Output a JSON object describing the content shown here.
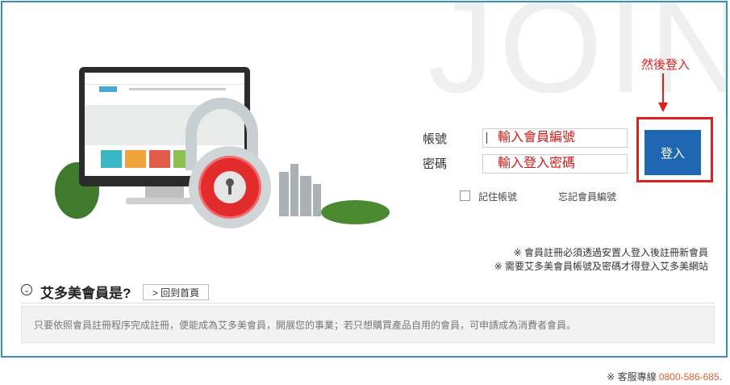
{
  "background_text": "JOIN",
  "annotation": {
    "text": "然後登入",
    "color": "#e0201f"
  },
  "form": {
    "account_label": "帳號",
    "account_placeholder": "輸入會員編號",
    "password_label": "密碼",
    "password_placeholder": "輸入登入密碼",
    "login_button": "登入",
    "remember_label": "記住帳號",
    "forgot_link": "忘記會員編號"
  },
  "notes": [
    "※ 會員註冊必須透過安置人登入後註冊新會員",
    "※ 需要艾多美會員帳號及密碼才得登入艾多美網站"
  ],
  "section": {
    "title": "艾多美會員是?",
    "home_button": "> 回到首頁",
    "description": "只要依照會員註冊程序完成註冊，便能成為艾多美會員，開展您的事業；若只想購買產品自用的會員，可申請成為消費者會員。"
  },
  "footer": {
    "label": "※ 客服專線",
    "phone": "0800-586-685."
  },
  "colors": {
    "accent_blue": "#1f66b3",
    "frame_border": "#3a8fb7",
    "highlight_red": "#e0201f",
    "phone_orange": "#e2622c"
  },
  "icons": {
    "section_toggle": "chevron-down-icon",
    "illustration": "padlock-monitor-illustration"
  }
}
